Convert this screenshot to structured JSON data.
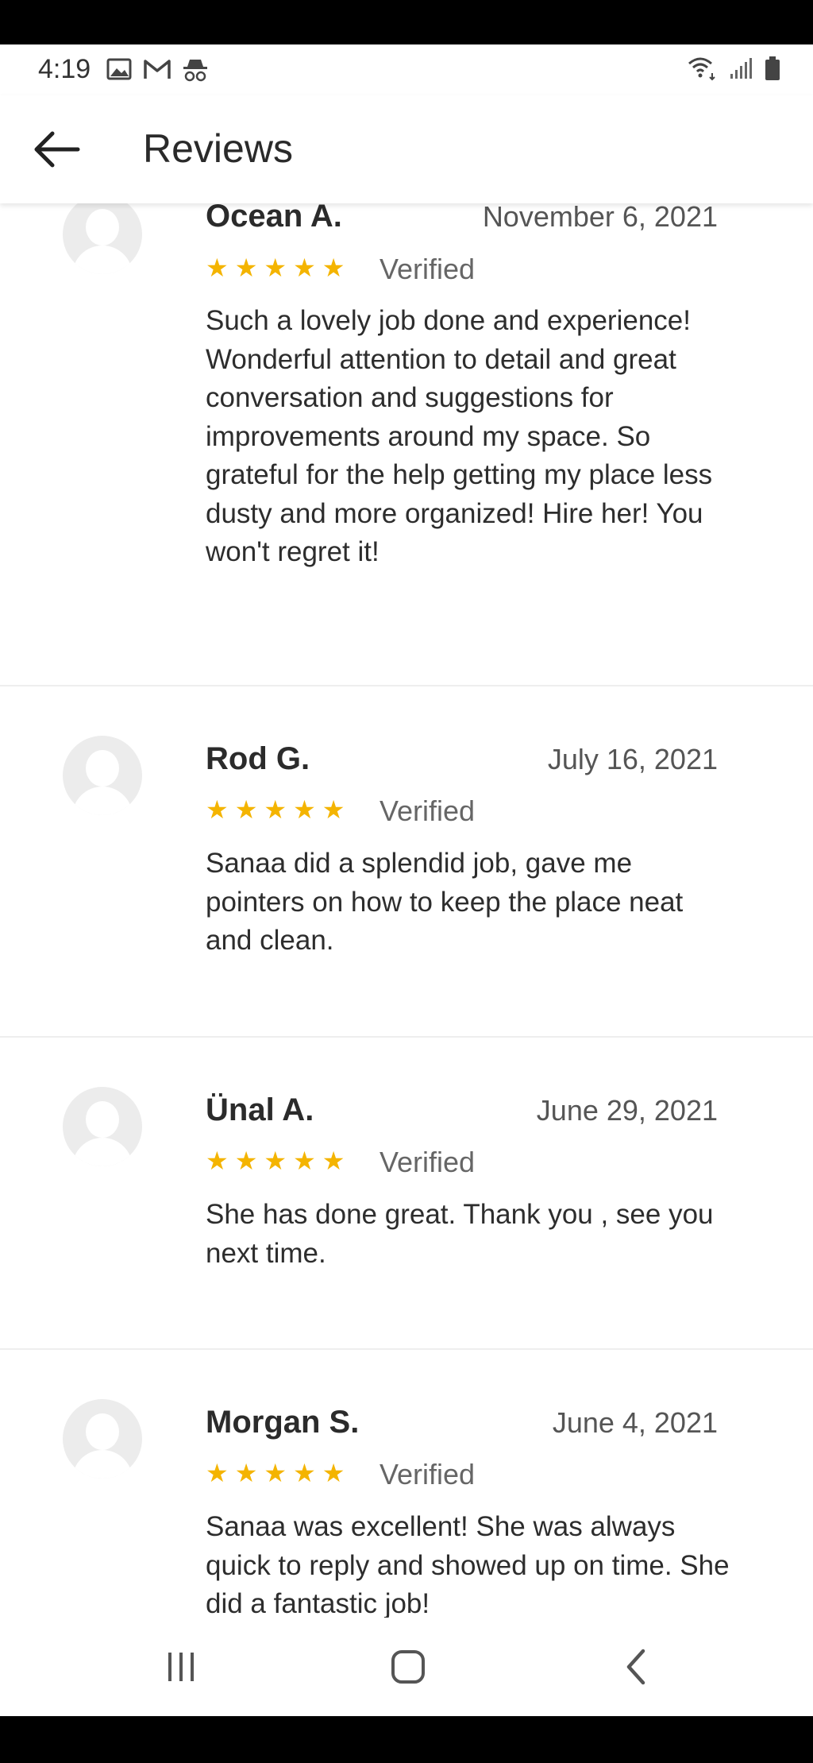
{
  "status_bar": {
    "time": "4:19"
  },
  "header": {
    "title": "Reviews"
  },
  "reviews": [
    {
      "name": "Ocean A.",
      "date": "November 6, 2021",
      "stars": "★★★★★",
      "verified": "Verified",
      "text": "Such a lovely job done and experience! Wonderful attention to detail and great conversation and suggestions for improvements around my space. So grateful for the help getting my place less dusty and more organized! Hire her! You won't regret it!"
    },
    {
      "name": "Rod G.",
      "date": "July 16, 2021",
      "stars": "★★★★★",
      "verified": "Verified",
      "text": "Sanaa did a splendid job, gave me pointers on how to keep the place neat and clean."
    },
    {
      "name": "Ünal A.",
      "date": "June 29, 2021",
      "stars": "★★★★★",
      "verified": "Verified",
      "text": "She has done great. Thank you , see you next time."
    },
    {
      "name": "Morgan S.",
      "date": "June 4, 2021",
      "stars": "★★★★★",
      "verified": "Verified",
      "text": "Sanaa was excellent! She was always quick to reply and showed up on time. She did a fantastic job!"
    }
  ],
  "colors": {
    "star": "#f4b400",
    "divider": "#eeeeee",
    "avatar_bg": "#ececec"
  },
  "icons": [
    "image-icon",
    "gmail-icon",
    "incognito-icon",
    "wifi-icon",
    "signal-icon",
    "battery-icon",
    "back-arrow-icon",
    "recent-apps-icon",
    "home-icon",
    "back-nav-icon"
  ]
}
